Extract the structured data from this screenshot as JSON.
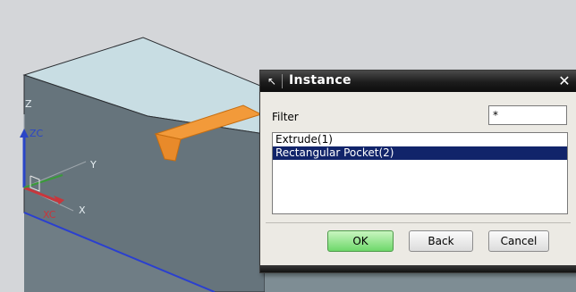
{
  "viewport": {
    "axis_labels": {
      "z": "Z",
      "zc": "ZC",
      "y": "Y",
      "xc": "XC",
      "x": "X"
    },
    "colors": {
      "background": "#d4d6d9",
      "block_top": "#c8dde3",
      "block_front": "#5f6d75",
      "block_side": "#7e8d94",
      "feature_highlight": "#f29a3a",
      "edge_blue": "#2a3fd0",
      "axis_z": "#2b46c7",
      "axis_x": "#c8363c",
      "axis_y": "#3a9a3a"
    }
  },
  "dialog": {
    "title": "Instance",
    "title_icon": "pointer-icon",
    "close_icon": "close-icon",
    "filter": {
      "label": "Filter",
      "value": "*"
    },
    "list_items": [
      {
        "label": "Extrude(1)",
        "selected": false
      },
      {
        "label": "Rectangular Pocket(2)",
        "selected": true
      }
    ],
    "buttons": {
      "ok": "OK",
      "back": "Back",
      "cancel": "Cancel"
    }
  }
}
